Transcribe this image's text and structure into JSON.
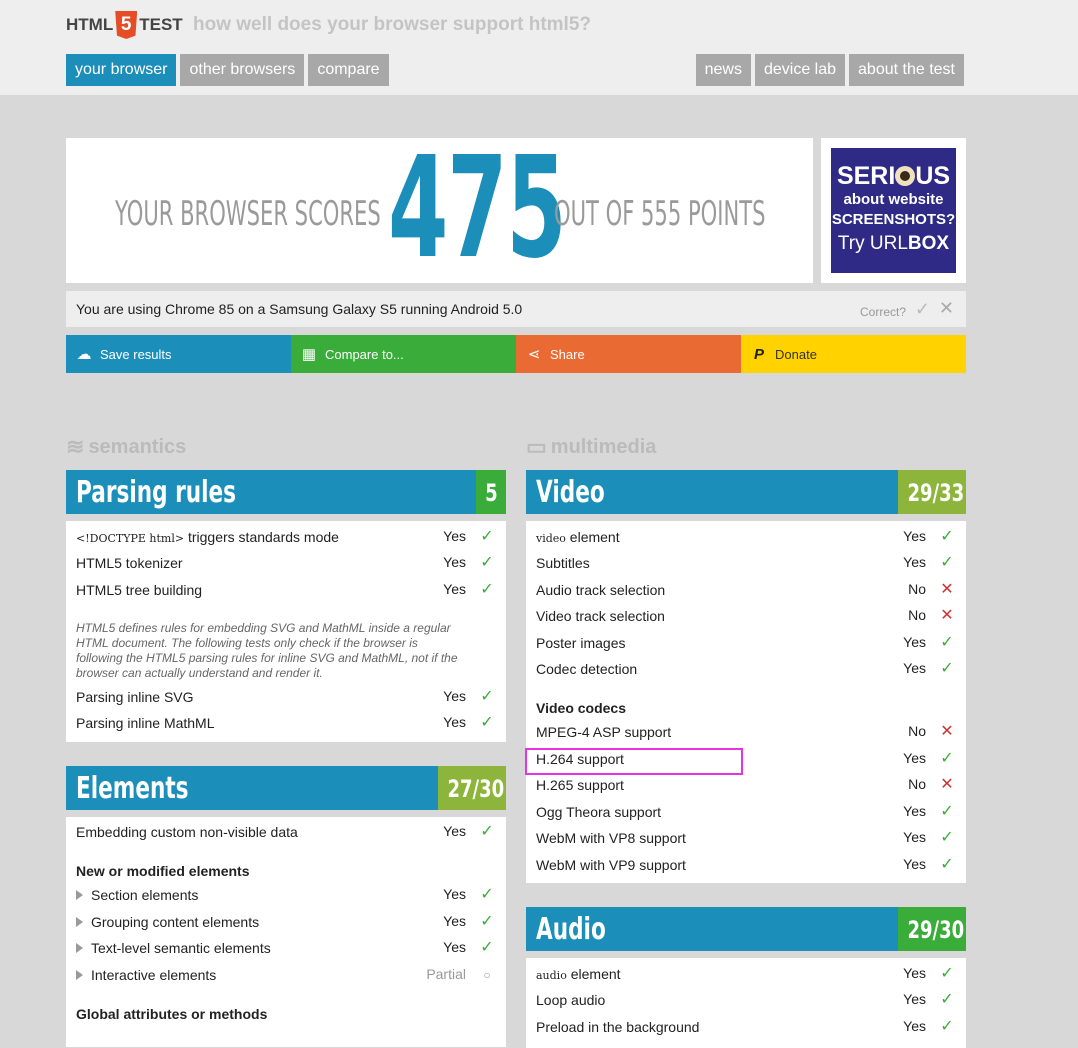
{
  "header": {
    "logo_left": "HTML",
    "logo_five": "5",
    "logo_right": "TEST",
    "tagline": "how well does your browser support html5?",
    "nav_left": [
      "your browser",
      "other browsers",
      "compare"
    ],
    "nav_right": [
      "news",
      "device lab",
      "about the test"
    ]
  },
  "score": {
    "lead": "YOUR BROWSER SCORES",
    "value": "475",
    "tail": "OUT OF 555 POINTS"
  },
  "ad": {
    "line1a": "SERI",
    "line1b": "US",
    "line2": "about website",
    "line3": "SCREENSHOTS?",
    "line4a": "Try URL",
    "line4b": "BOX"
  },
  "ua": {
    "text": "You are using Chrome 85 on a Samsung Galaxy S5 running Android 5.0",
    "correct": "Correct?"
  },
  "actions": {
    "save": "Save results",
    "compare": "Compare to...",
    "share": "Share",
    "donate": "Donate"
  },
  "categories": {
    "semantics": "semantics",
    "multimedia": "multimedia"
  },
  "parsing": {
    "title": "Parsing rules",
    "score": "5",
    "rows": [
      {
        "code": "<!DOCTYPE html>",
        "label": " triggers standards mode",
        "result": "Yes"
      },
      {
        "label": "HTML5 tokenizer",
        "result": "Yes"
      },
      {
        "label": "HTML5 tree building",
        "result": "Yes"
      }
    ],
    "note": "HTML5 defines rules for embedding SVG and MathML inside a regular HTML document. The following tests only check if the browser is following the HTML5 parsing rules for inline SVG and MathML, not if the browser can actually understand and render it.",
    "rows2": [
      {
        "label": "Parsing inline SVG",
        "result": "Yes"
      },
      {
        "label": "Parsing inline MathML",
        "result": "Yes"
      }
    ]
  },
  "elements": {
    "title": "Elements",
    "score": "27/30",
    "row1": {
      "label": "Embedding custom non-visible data",
      "result": "Yes"
    },
    "sub1": "New or modified elements",
    "rows": [
      {
        "label": "Section elements",
        "result": "Yes"
      },
      {
        "label": "Grouping content elements",
        "result": "Yes"
      },
      {
        "label": "Text-level semantic elements",
        "result": "Yes"
      },
      {
        "label": "Interactive elements",
        "result": "Partial"
      }
    ],
    "sub2": "Global attributes or methods"
  },
  "video": {
    "title": "Video",
    "score": "29/33",
    "rows": [
      {
        "code": "video",
        "label": " element",
        "result": "Yes"
      },
      {
        "label": "Subtitles",
        "result": "Yes"
      },
      {
        "label": "Audio track selection",
        "result": "No"
      },
      {
        "label": "Video track selection",
        "result": "No"
      },
      {
        "label": "Poster images",
        "result": "Yes"
      },
      {
        "label": "Codec detection",
        "result": "Yes"
      }
    ],
    "codecs_title": "Video codecs",
    "codecs": [
      {
        "label": "MPEG-4 ASP support",
        "result": "No"
      },
      {
        "label": "H.264 support",
        "result": "Yes"
      },
      {
        "label": "H.265 support",
        "result": "No"
      },
      {
        "label": "Ogg Theora support",
        "result": "Yes"
      },
      {
        "label": "WebM with VP8 support",
        "result": "Yes"
      },
      {
        "label": "WebM with VP9 support",
        "result": "Yes"
      }
    ]
  },
  "audio": {
    "title": "Audio",
    "score": "29/30",
    "rows": [
      {
        "code": "audio",
        "label": " element",
        "result": "Yes"
      },
      {
        "label": "Loop audio",
        "result": "Yes"
      },
      {
        "label": "Preload in the background",
        "result": "Yes"
      }
    ]
  },
  "colors": {
    "blue": "#1b8fba",
    "green": "#3aac3a",
    "olive": "#8db53c",
    "orange": "#ea6a33",
    "yellow": "#ffd200",
    "highlight": "#e533e5"
  }
}
